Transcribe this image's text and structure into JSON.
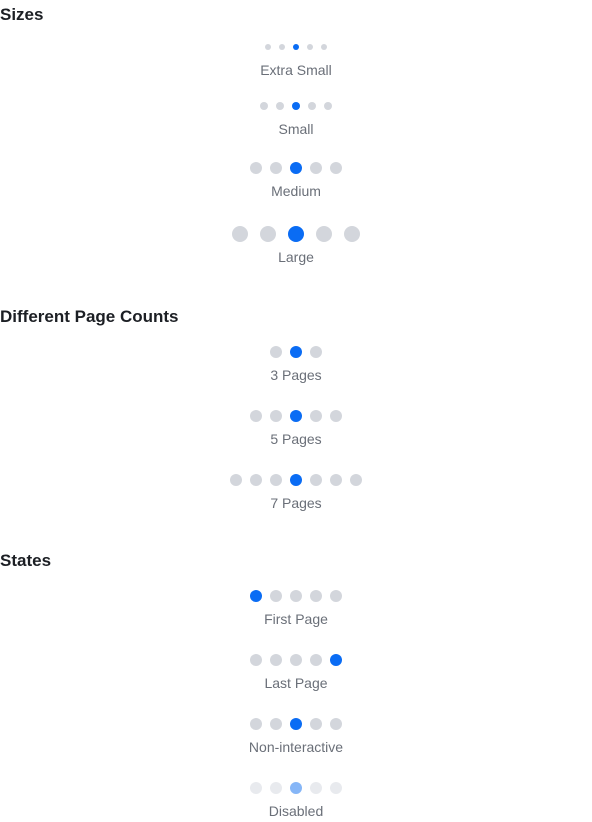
{
  "sections": [
    {
      "title": "Sizes",
      "examples": [
        {
          "label": "Extra Small",
          "size": "xs",
          "pages": 5,
          "active": 3,
          "state": "default"
        },
        {
          "label": "Small",
          "size": "sm",
          "pages": 5,
          "active": 3,
          "state": "default"
        },
        {
          "label": "Medium",
          "size": "md",
          "pages": 5,
          "active": 3,
          "state": "default"
        },
        {
          "label": "Large",
          "size": "lg",
          "pages": 5,
          "active": 3,
          "state": "default"
        }
      ]
    },
    {
      "title": "Different Page Counts",
      "examples": [
        {
          "label": "3 Pages",
          "size": "md",
          "pages": 3,
          "active": 2,
          "state": "default"
        },
        {
          "label": "5 Pages",
          "size": "md",
          "pages": 5,
          "active": 3,
          "state": "default"
        },
        {
          "label": "7 Pages",
          "size": "md",
          "pages": 7,
          "active": 4,
          "state": "default"
        }
      ]
    },
    {
      "title": "States",
      "examples": [
        {
          "label": "First Page",
          "size": "md",
          "pages": 5,
          "active": 1,
          "state": "default"
        },
        {
          "label": "Last Page",
          "size": "md",
          "pages": 5,
          "active": 5,
          "state": "default"
        },
        {
          "label": "Non-interactive",
          "size": "md",
          "pages": 5,
          "active": 3,
          "state": "non-interactive"
        },
        {
          "label": "Disabled",
          "size": "md",
          "pages": 5,
          "active": 3,
          "state": "disabled"
        }
      ]
    }
  ],
  "colors": {
    "active": "#0a6cf4",
    "inactive": "#d3d6dc",
    "disabled_inactive": "#e8eaee",
    "disabled_active": "#86b6f7",
    "title": "#1c1f24",
    "caption": "#6a6f78"
  }
}
